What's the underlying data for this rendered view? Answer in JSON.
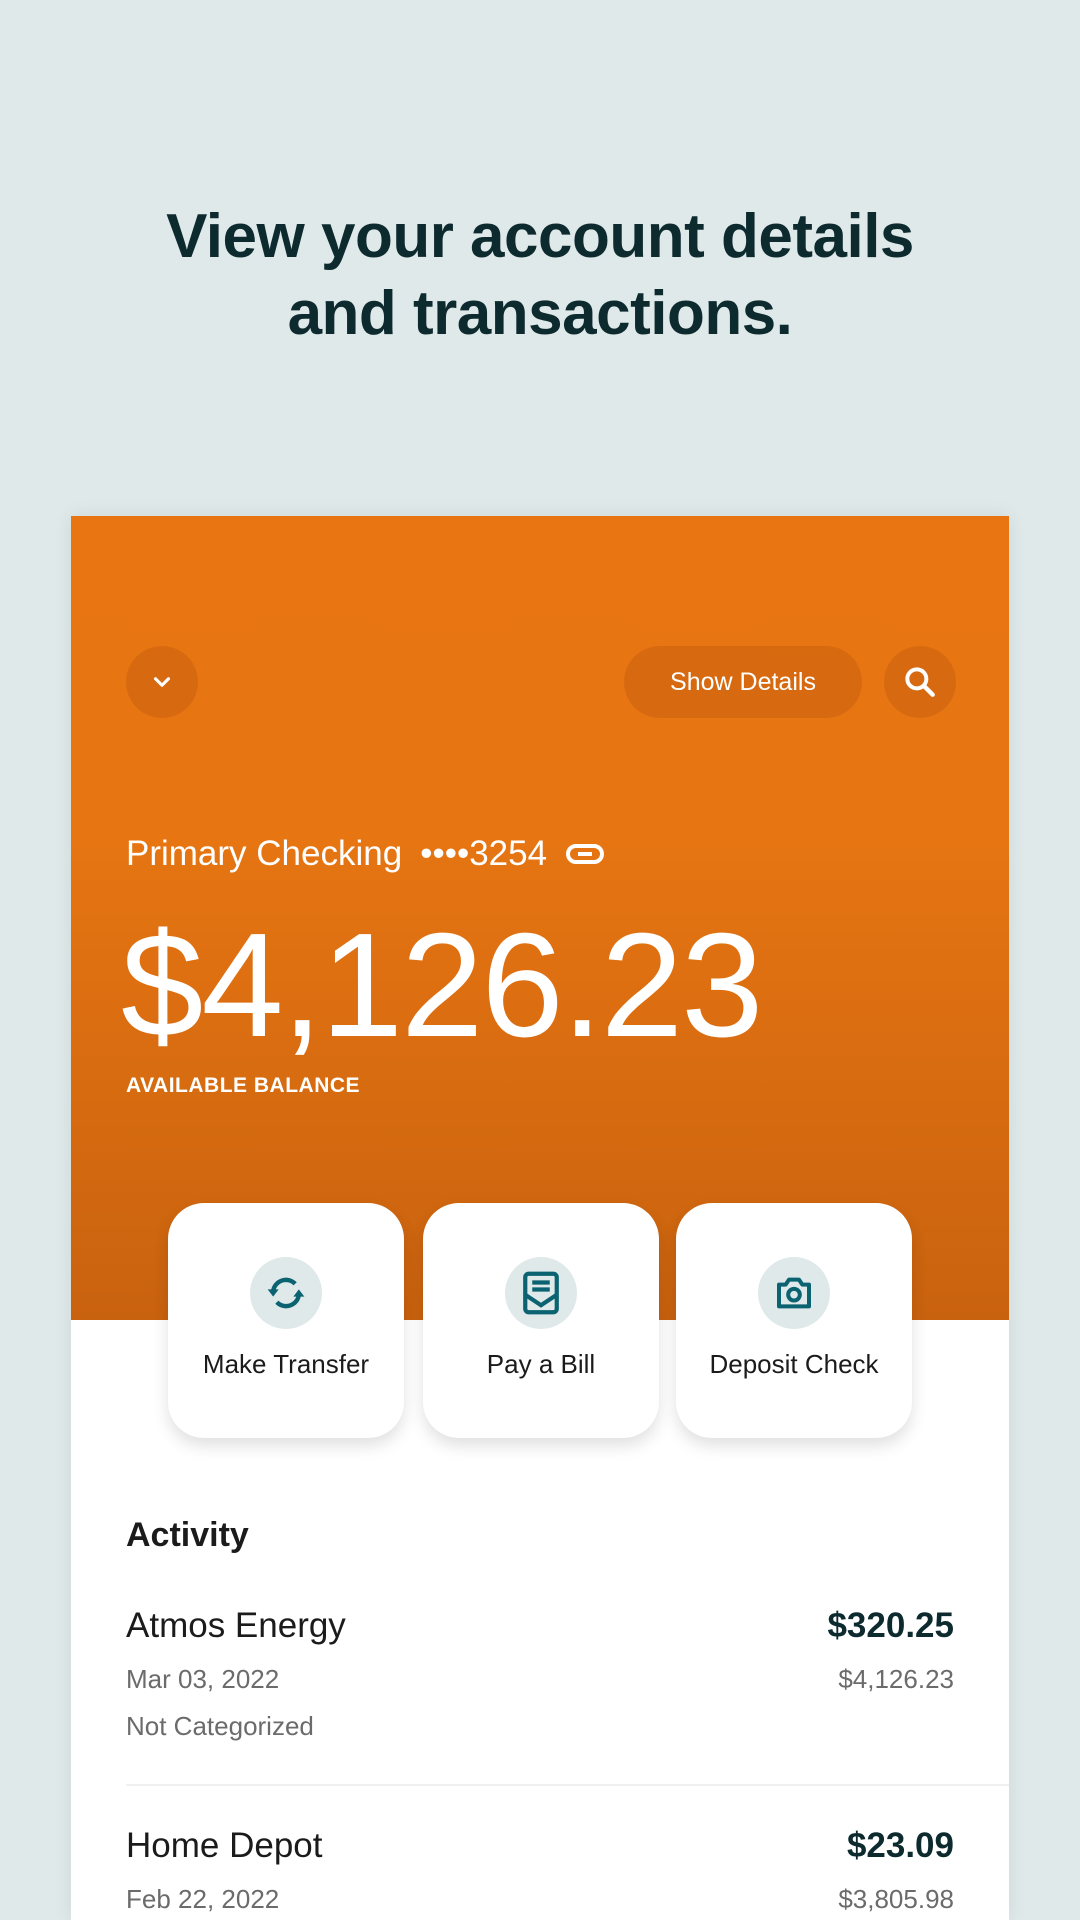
{
  "headline": {
    "line1": "View your account details",
    "line2": "and transactions."
  },
  "colors": {
    "brand_orange": "#e87511",
    "brand_orange_dark": "#c9620f",
    "teal_icon": "#0b6372",
    "text_dark": "#0d2a2e",
    "background": "#dfe9e9"
  },
  "header": {
    "account_switcher_icon": "chevron-down-icon",
    "show_details_label": "Show Details",
    "search_icon": "search-icon"
  },
  "account": {
    "name": "Primary Checking",
    "masked_number": "••••3254",
    "link_icon": "link-icon",
    "balance": "$4,126.23",
    "balance_label": "AVAILABLE BALANCE"
  },
  "actions": [
    {
      "label": "Make Transfer",
      "icon": "transfer-icon"
    },
    {
      "label": "Pay a Bill",
      "icon": "bill-envelope-icon"
    },
    {
      "label": "Deposit Check",
      "icon": "camera-icon"
    }
  ],
  "activity": {
    "title": "Activity",
    "transactions": [
      {
        "name": "Atmos Energy",
        "amount": "$320.25",
        "date": "Mar 03, 2022",
        "running_balance": "$4,126.23",
        "category": "Not Categorized"
      },
      {
        "name": "Home Depot",
        "amount": "$23.09",
        "date": "Feb 22, 2022",
        "running_balance": "$3,805.98"
      }
    ]
  }
}
